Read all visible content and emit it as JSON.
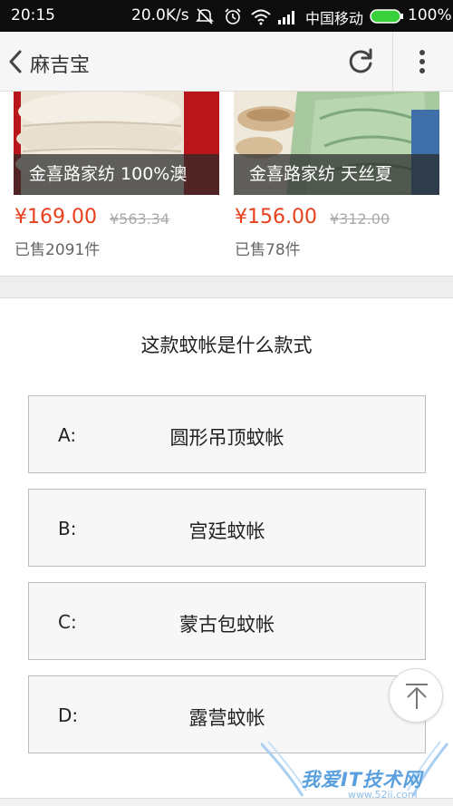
{
  "status_bar": {
    "time": "20:15",
    "network_speed": "20.0K/s",
    "carrier": "中国移动",
    "battery": "100%"
  },
  "header": {
    "title": "麻吉宝",
    "icons": [
      "back-icon",
      "refresh-icon",
      "more-icon"
    ]
  },
  "products": [
    {
      "caption": "金喜路家纺 100%澳",
      "price": "¥169.00",
      "original_price": "¥563.34",
      "sold": "已售2091件"
    },
    {
      "caption": "金喜路家纺 天丝夏",
      "price": "¥156.00",
      "original_price": "¥312.00",
      "sold": "已售78件"
    }
  ],
  "quiz": {
    "question": "这款蚊帐是什么款式",
    "options": [
      {
        "letter": "A:",
        "text": "圆形吊顶蚊帐"
      },
      {
        "letter": "B:",
        "text": "宫廷蚊帐"
      },
      {
        "letter": "C:",
        "text": "蒙古包蚊帐"
      },
      {
        "letter": "D:",
        "text": "露营蚊帐"
      }
    ]
  },
  "watermark": {
    "text": "我爱IT技术网",
    "url": "www.52ij.com"
  },
  "colors": {
    "price": "#e8401c",
    "status_bar": "#0d0d0d",
    "battery": "#38d13c"
  }
}
